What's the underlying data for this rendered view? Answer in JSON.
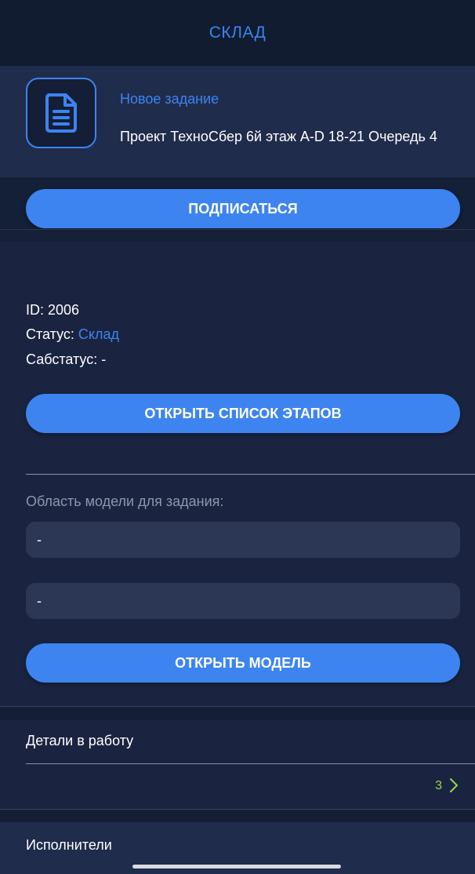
{
  "header": {
    "title": "СКЛАД"
  },
  "task": {
    "title": "Новое задание",
    "description": "Проект ТехноСбер 6й этаж A-D 18-21 Очередь 4"
  },
  "actions": {
    "subscribe_label": "ПОДПИСАТЬСЯ",
    "stages_label": "ОТКРЫТЬ СПИСОК ЭТАПОВ",
    "model_label": "ОТКРЫТЬ МОДЕЛЬ"
  },
  "info": {
    "id_line": "ID: 2006",
    "status_label": "Статус: ",
    "status_value": "Склад",
    "substatus_line": "Сабстатус: -"
  },
  "model_area": {
    "label": "Область модели для задания:",
    "field_1": "-",
    "field_2": "-"
  },
  "details": {
    "title": "Детали в работу",
    "count": "3"
  },
  "executors": {
    "title": "Исполнители"
  },
  "colors": {
    "accent": "#3d84f0",
    "background": "#1a2440",
    "header_bg": "#111c30",
    "count_green": "#9bd54a"
  },
  "icons": {
    "task": "document-icon",
    "details_arrow": "chevron-right-icon"
  }
}
